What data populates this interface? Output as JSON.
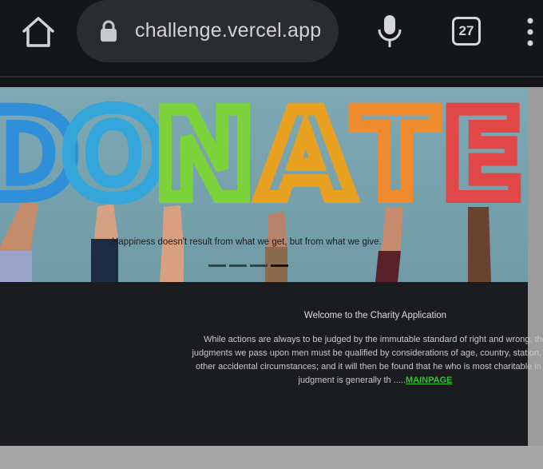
{
  "browser": {
    "url": "challenge.vercel.app",
    "tab_count": "27",
    "icons": [
      "home-icon",
      "lock-icon",
      "microphone-icon",
      "tab-switcher-icon",
      "more-menu-icon"
    ]
  },
  "hero": {
    "banner_letters": [
      "D",
      "O",
      "N",
      "A",
      "T",
      "E"
    ],
    "balloon_colors": [
      "#2f8fd9",
      "#35a6d9",
      "#7bd23a",
      "#e8a020",
      "#ef8a2d",
      "#e24747"
    ],
    "caption": "Happiness doesn't result from what we get, but from what we give.",
    "carousel_slides": 4,
    "carousel_active": 4
  },
  "content": {
    "welcome": "Welcome to the Charity Application",
    "body_lines": [
      "While actions are always to be judged by the immutable standard of right and wrong, the",
      "judgments we pass upon men must be qualified by considerations of age, country, station, and",
      "other accidental circumstances; and it will then be found that he who is most charitable in his"
    ],
    "last_line": "judgment is generally th .....",
    "link_label": "MAINPAGE"
  }
}
